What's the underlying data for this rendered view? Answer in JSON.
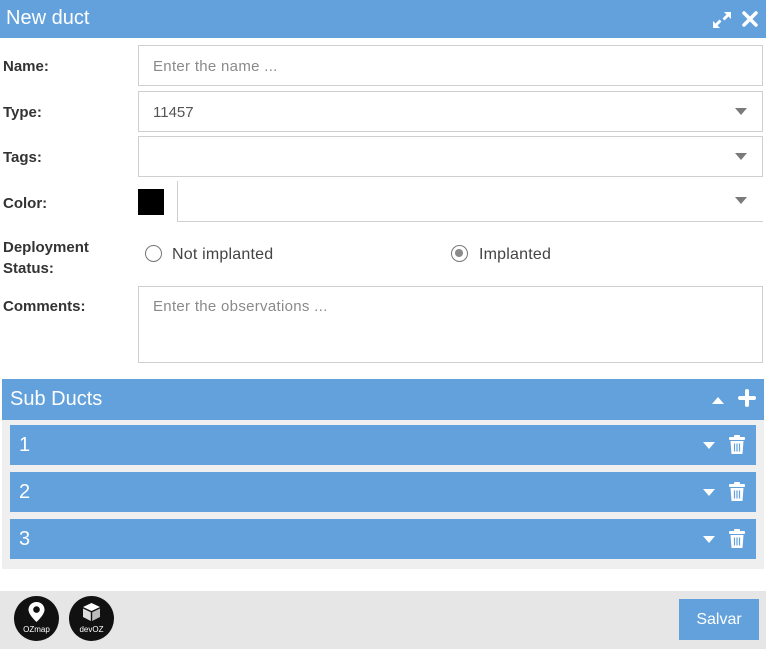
{
  "window": {
    "title": "New duct",
    "expand_icon": "expand-icon",
    "close_icon": "close-icon"
  },
  "form": {
    "name": {
      "label": "Name:",
      "placeholder": "Enter the name ..."
    },
    "type": {
      "label": "Type:",
      "value": "11457"
    },
    "tags": {
      "label": "Tags:",
      "value": ""
    },
    "color": {
      "label": "Color:",
      "swatch": "#000000",
      "value": ""
    },
    "deployment": {
      "label_line1": "Deployment",
      "label_line2": "Status:",
      "options": [
        "Not implanted",
        "Implanted"
      ],
      "selected": "Implanted"
    },
    "comments": {
      "label": "Comments:",
      "placeholder": "Enter the observations ..."
    }
  },
  "sub_ducts": {
    "title": "Sub Ducts",
    "items": [
      {
        "label": "1"
      },
      {
        "label": "2"
      },
      {
        "label": "3"
      }
    ]
  },
  "footer": {
    "logos": [
      {
        "text": "OZmap",
        "icon": "map-pin-icon"
      },
      {
        "text": "devOZ",
        "icon": "cube-icon"
      }
    ],
    "save_label": "Salvar"
  },
  "colors": {
    "accent": "#62a1dc",
    "footer_bg": "#e6e6e6",
    "panel_bg": "#efefef"
  }
}
